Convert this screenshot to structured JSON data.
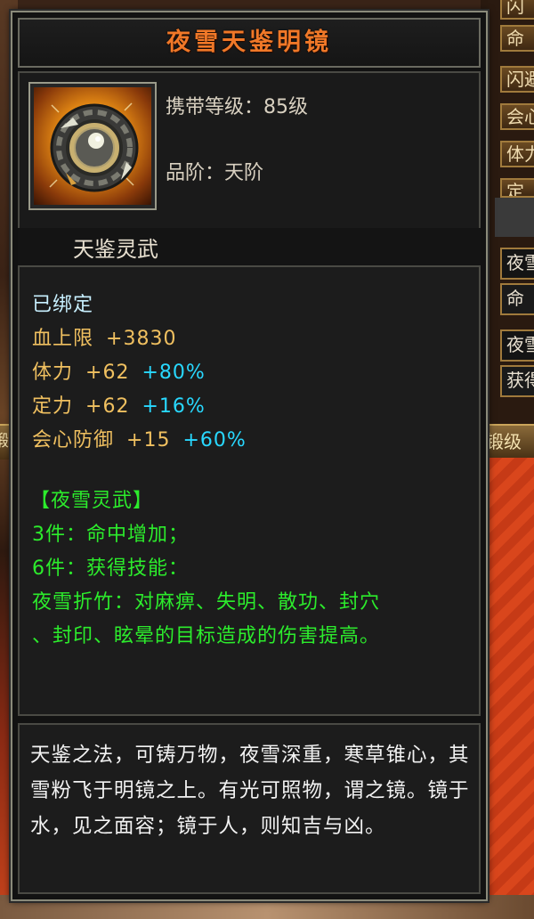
{
  "item": {
    "name": "夜雪天鉴明镜",
    "level_label": "携带等级：85级",
    "grade_label": "品阶：天阶",
    "category": "天鉴灵武"
  },
  "stats": {
    "bound": "已绑定",
    "hp": {
      "label": "血上限",
      "value": "+3830"
    },
    "stamina": {
      "label": "体力",
      "value": "+62",
      "pct": "+80%"
    },
    "focus": {
      "label": "定力",
      "value": "+62",
      "pct": "+16%"
    },
    "crit_def": {
      "label": "会心防御",
      "value": "+15",
      "pct": "+60%"
    }
  },
  "set": {
    "name": "【夜雪灵武】",
    "bonus3": "3件：命中增加；",
    "bonus6": "6件：获得技能：",
    "skill_line1": "夜雪折竹：对麻痹、失明、散功、封穴",
    "skill_line2": "、封印、眩晕的目标造成的伤害提高。"
  },
  "description": "天鉴之法，可铸万物，夜雪深重，寒草锥心，其雪粉飞于明镜之上。有光可照物，谓之镜。镜于水，见之面容；镜于人，则知吉与凶。",
  "background": {
    "tabs_right": [
      "闪",
      "命",
      "闪避",
      "会心",
      "体力",
      "定"
    ],
    "tabs_right_lower": [
      "夜雪",
      "命",
      "夜雪",
      "获得"
    ],
    "bar_right": "锻级",
    "bar_left": "锻"
  },
  "colors": {
    "title": "#f07828",
    "stat": "#f0c060",
    "percent": "#28d8ff",
    "set": "#2cec2c",
    "bound": "#c8f0ff"
  }
}
